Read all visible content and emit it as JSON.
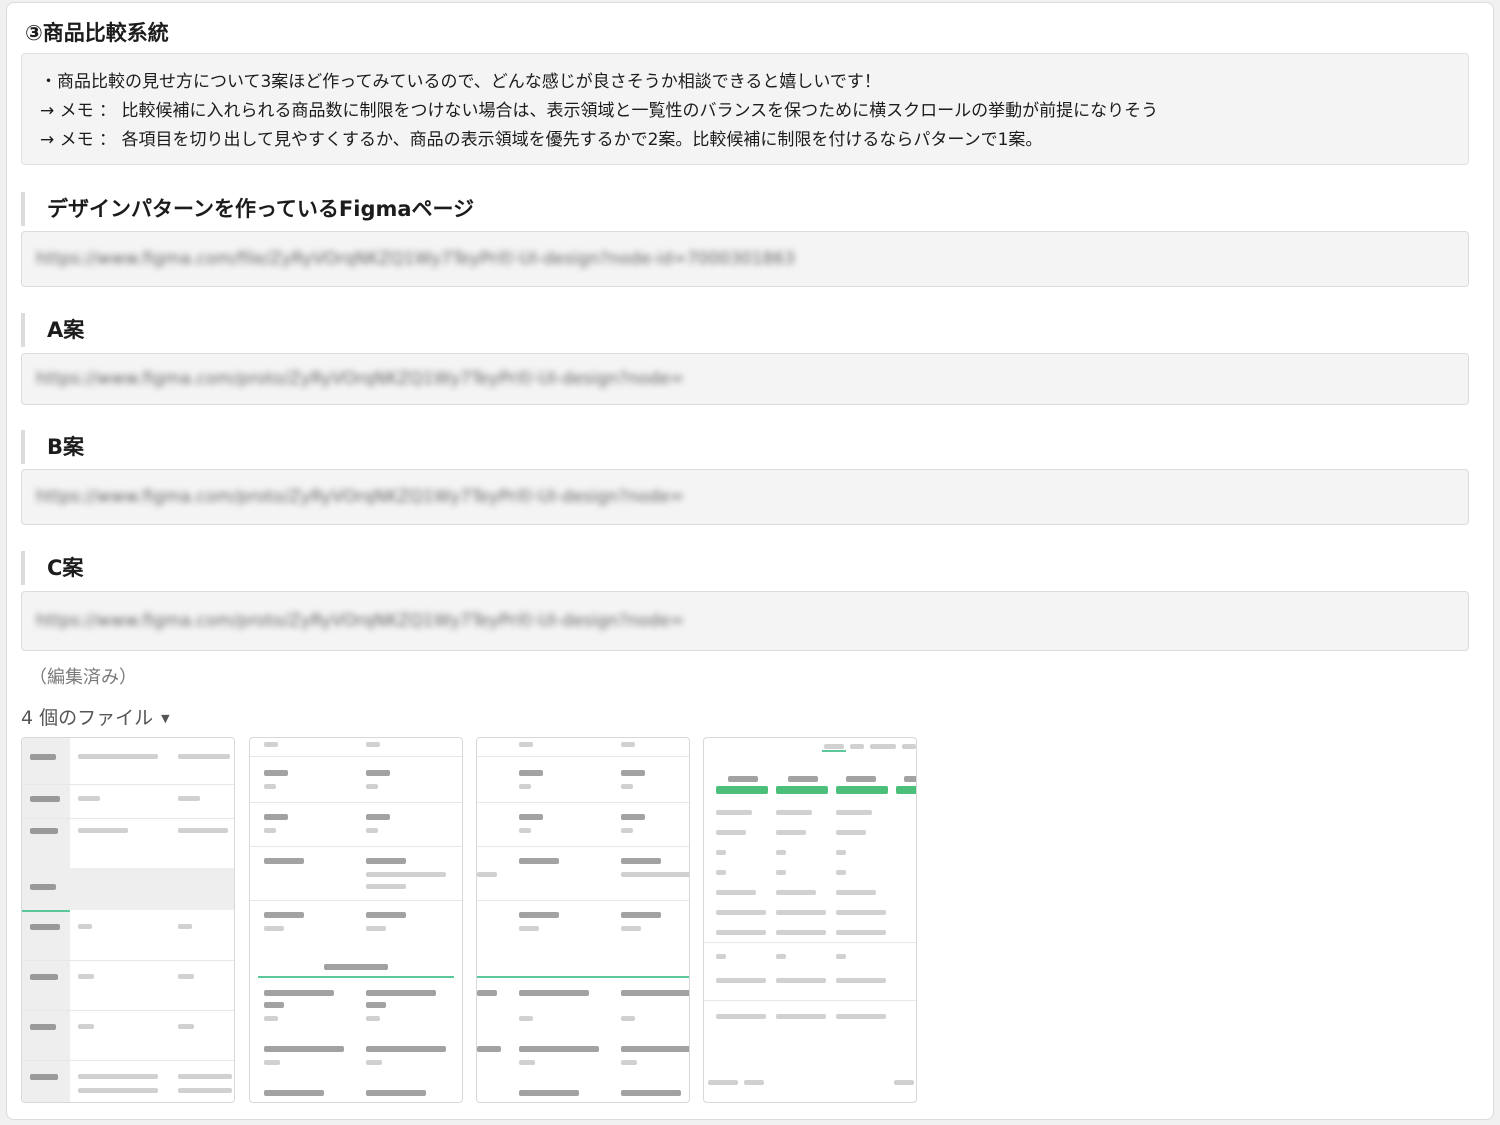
{
  "section_title": "③商品比較系統",
  "notes": [
    "・商品比較の見せ方について3案ほど作ってみているので、どんな感じが良さそうか相談できると嬉しいです！",
    "→ メモ ： 比較候補に入れられる商品数に制限をつけない場合は、表示領域と一覧性のバランスを保つために横スクロールの挙動が前提になりそう",
    "→ メモ ： 各項目を切り出して見やすくするか、商品の表示領域を優先するかで2案。比較候補に制限を付けるならパターンで1案。"
  ],
  "figma_page": {
    "label": "デザインパターンを作っているFigmaページ",
    "url": "https://www.figma.com/file/ZyRyVOrqNKZQ1Wy7TeyPrif/-UI-design?node-id=7000301863"
  },
  "proposals": [
    {
      "label": "A案",
      "url": "https://www.figma.com/proto/ZyRyVOrqNKZQ1Wy7TeyPrif/-UI-design?node="
    },
    {
      "label": "B案",
      "url": "https://www.figma.com/proto/ZyRyVOrqNKZQ1Wy7TeyPrif/-UI-design?node="
    },
    {
      "label": "C案",
      "url": "https://www.figma.com/proto/ZyRyVOrqNKZQ1Wy7TeyPrif/-UI-design?node="
    }
  ],
  "edited_label": "（編集済み）",
  "files": {
    "toggle_label": "4 個のファイル"
  },
  "colors": {
    "card_bg": "#ffffff",
    "box_bg": "#f4f4f4",
    "accent_green": "#5cc79a"
  }
}
